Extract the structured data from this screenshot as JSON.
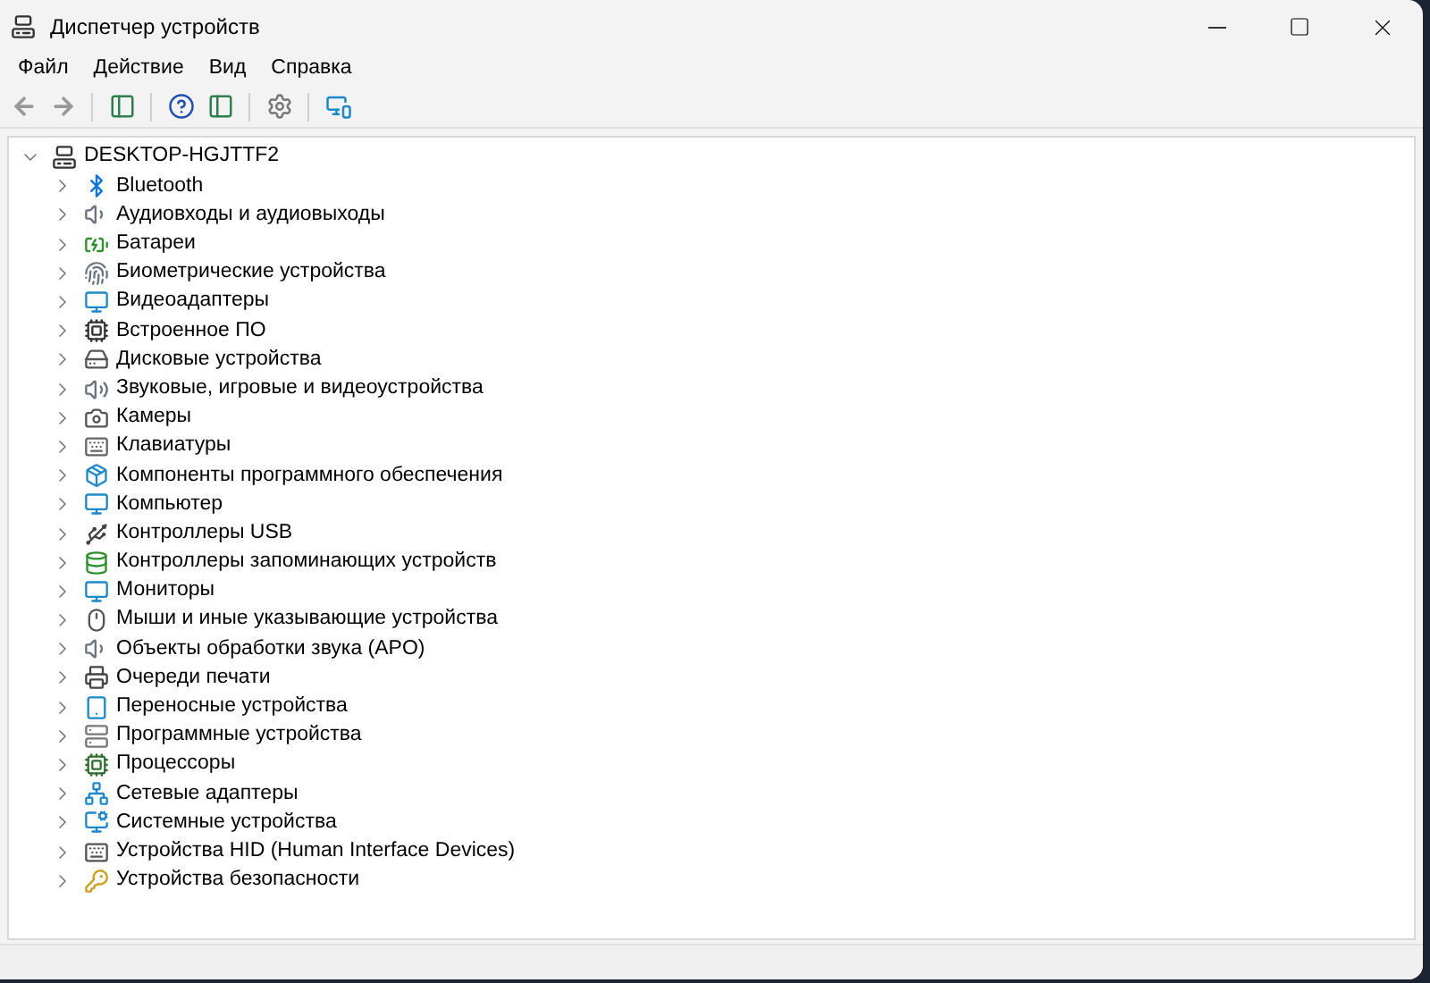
{
  "window": {
    "title": "Диспетчер устройств"
  },
  "menu": [
    "Файл",
    "Действие",
    "Вид",
    "Справка"
  ],
  "tree": {
    "label": "DESKTOP-HGJTTF2",
    "expanded": true,
    "children": [
      {
        "label": "Bluetooth",
        "expanded": false
      },
      {
        "label": "Аудиовходы и аудиовыходы",
        "expanded": false
      },
      {
        "label": "Батареи",
        "expanded": false
      },
      {
        "label": "Биометрические устройства",
        "expanded": false
      },
      {
        "label": "Видеоадаптеры",
        "expanded": false
      },
      {
        "label": "Встроенное ПО",
        "expanded": false
      },
      {
        "label": "Дисковые устройства",
        "expanded": false
      },
      {
        "label": "Звуковые, игровые и видеоустройства",
        "expanded": false
      },
      {
        "label": "Камеры",
        "expanded": false
      },
      {
        "label": "Клавиатуры",
        "expanded": false
      },
      {
        "label": "Компоненты программного обеспечения",
        "expanded": false
      },
      {
        "label": "Компьютер",
        "expanded": false
      },
      {
        "label": "Контроллеры USB",
        "expanded": false
      },
      {
        "label": "Контроллеры запоминающих устройств",
        "expanded": false
      },
      {
        "label": "Мониторы",
        "expanded": false
      },
      {
        "label": "Мыши и иные указывающие устройства",
        "expanded": false
      },
      {
        "label": "Объекты обработки звука (APO)",
        "expanded": false
      },
      {
        "label": "Очереди печати",
        "expanded": false
      },
      {
        "label": "Переносные устройства",
        "expanded": false
      },
      {
        "label": "Программные устройства",
        "expanded": false
      },
      {
        "label": "Процессоры",
        "expanded": false
      },
      {
        "label": "Сетевые адаптеры",
        "expanded": false
      },
      {
        "label": "Системные устройства",
        "expanded": false
      },
      {
        "label": "Устройства HID (Human Interface Devices)",
        "expanded": false
      },
      {
        "label": "Устройства безопасности",
        "expanded": false
      }
    ]
  }
}
